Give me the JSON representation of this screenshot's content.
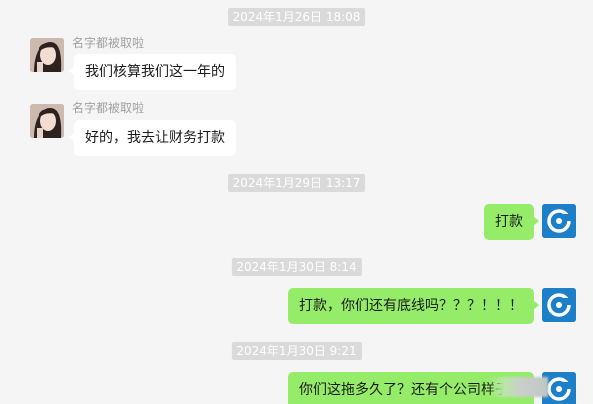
{
  "theme": {
    "background": "#f5f5f5",
    "incoming_bubble": "#ffffff",
    "outgoing_bubble": "#95ec69",
    "timestamp_bg": "#dadada",
    "logo_blue": "#1e7fc9"
  },
  "messages": [
    {
      "timestamp": "2024年1月26日 18:08"
    },
    {
      "sender": "名字都被取啦",
      "text": "我们核算我们这一年的",
      "avatar_icon": "user-avatar-photo"
    },
    {
      "sender": "名字都被取啦",
      "text": "好的，我去让财务打款",
      "avatar_icon": "user-avatar-photo"
    },
    {
      "timestamp": "2024年1月29日 13:17"
    },
    {
      "text": "打款",
      "avatar_icon": "company-logo-icon"
    },
    {
      "timestamp": "2024年1月30日 8:14"
    },
    {
      "text": "打款，你们还有底线吗？？？！！！",
      "avatar_icon": "company-logo-icon"
    },
    {
      "timestamp": "2024年1月30日 9:21"
    },
    {
      "text": "你们这拖多久了？还有个公司样子吗",
      "avatar_icon": "company-logo-icon"
    }
  ]
}
